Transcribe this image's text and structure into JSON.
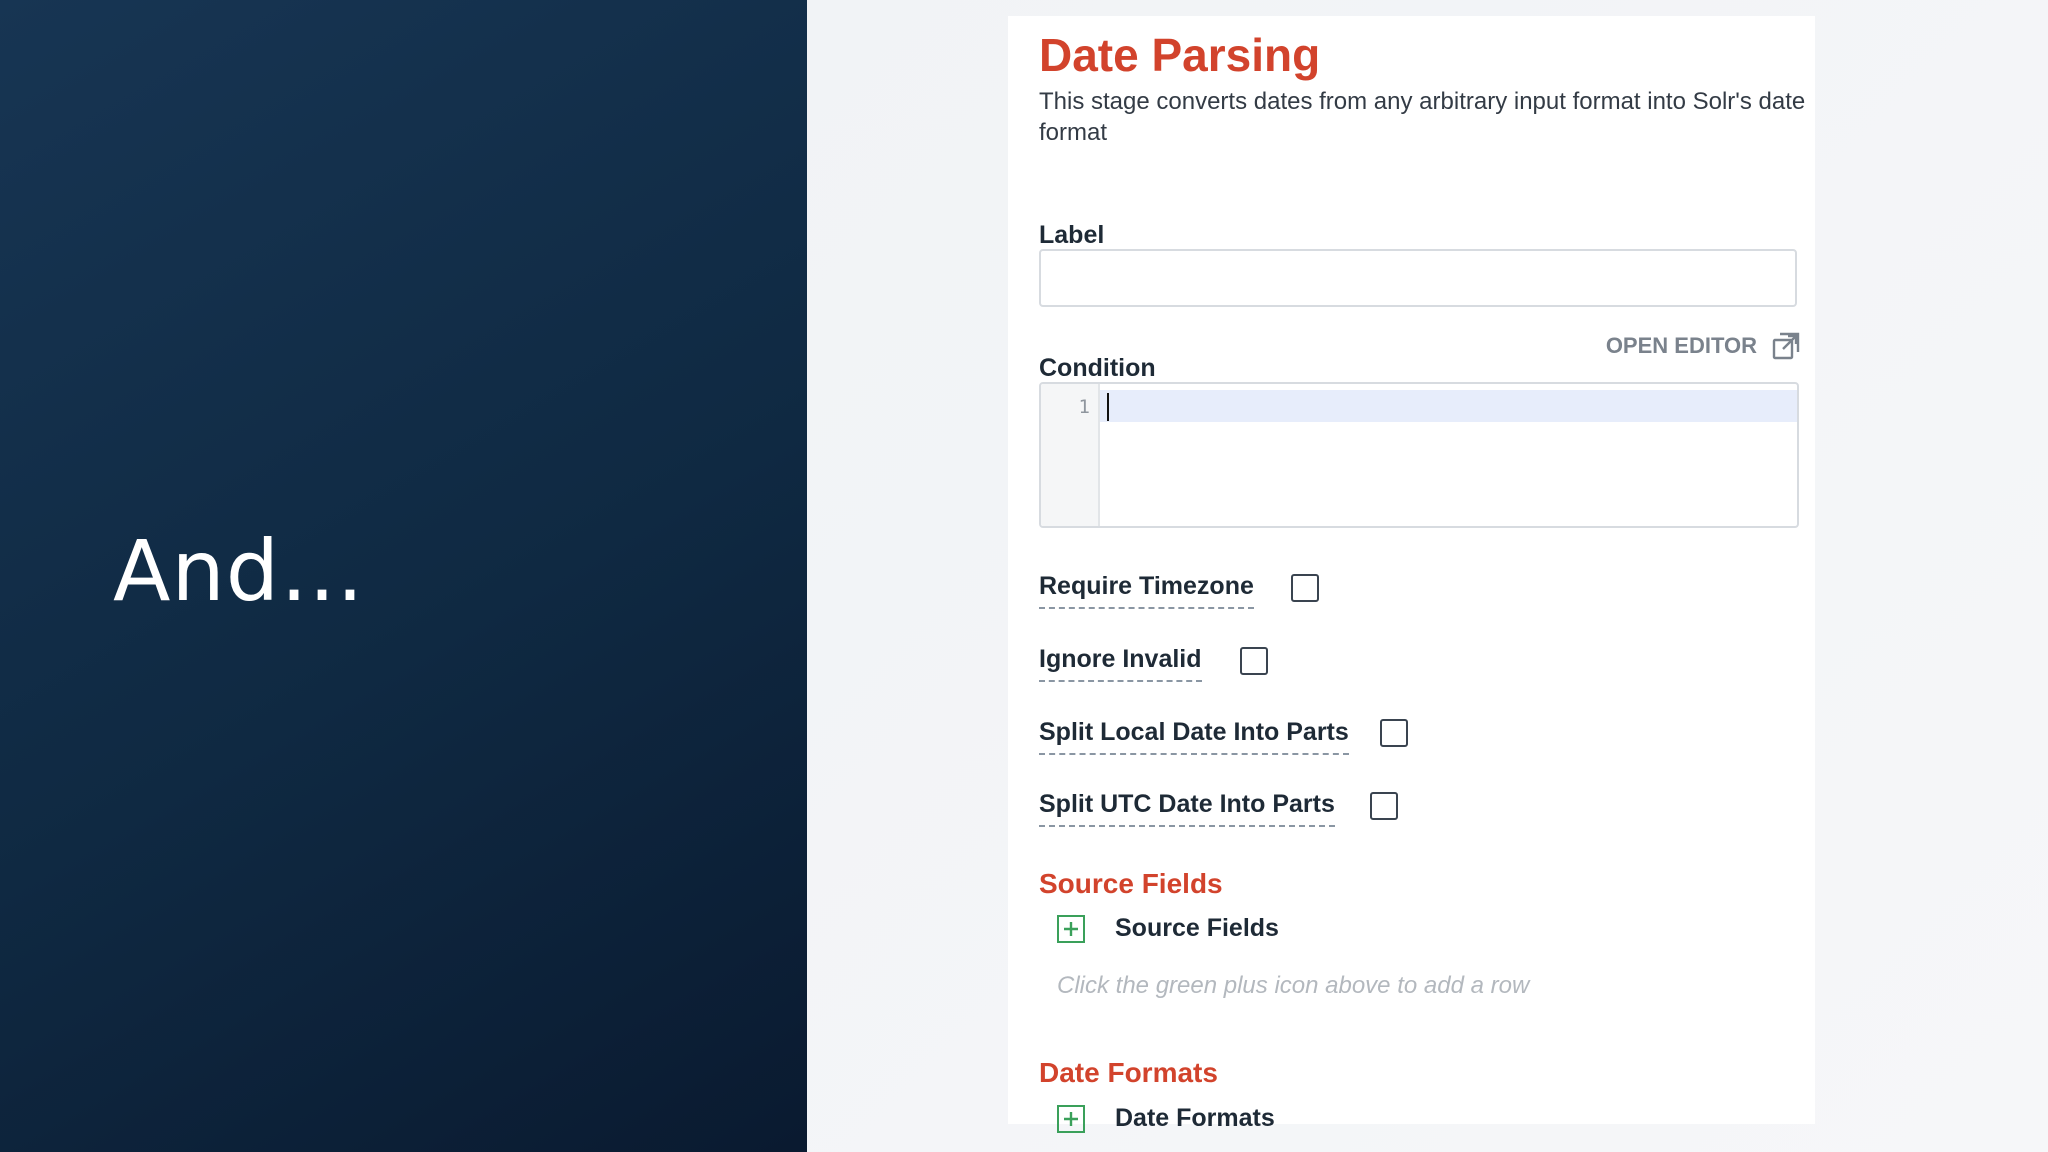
{
  "slide": {
    "title": "And…"
  },
  "stage": {
    "title": "Date Parsing",
    "description": "This stage converts dates from any arbitrary input format into Solr's date format"
  },
  "fields": {
    "label": {
      "label": "Label",
      "value": "",
      "placeholder": ""
    },
    "condition": {
      "label": "Condition",
      "open_editor": "OPEN EDITOR",
      "open_editor_icon": "external-link-icon",
      "line_number": "1"
    },
    "checkboxes": [
      {
        "label": "Require Timezone",
        "checked": false
      },
      {
        "label": "Ignore Invalid",
        "checked": false
      },
      {
        "label": "Split Local Date Into Parts",
        "checked": false
      },
      {
        "label": "Split UTC Date Into Parts",
        "checked": false
      }
    ]
  },
  "sections": {
    "source_fields": {
      "title": "Source Fields",
      "add_label": "Source Fields",
      "empty_hint": "Click the green plus icon above to add a row"
    },
    "date_formats": {
      "title": "Date Formats",
      "add_label": "Date Formats"
    }
  },
  "colors": {
    "accent_red": "#d2432c",
    "add_green": "#3aa05a",
    "left_panel": "#132c48"
  }
}
